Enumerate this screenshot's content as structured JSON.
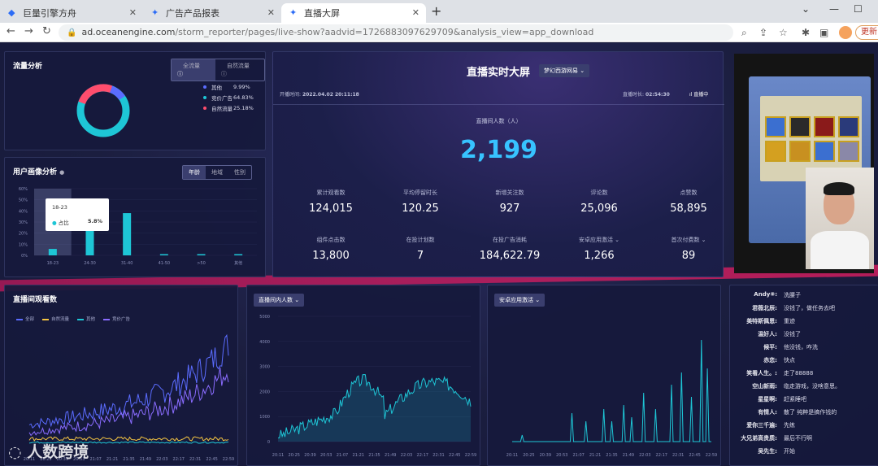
{
  "browser": {
    "tabs": [
      {
        "label": "巨量引擎方舟"
      },
      {
        "label": "广告产品报表"
      },
      {
        "label": "直播大屏"
      }
    ],
    "url_host": "ad.oceanengine.com",
    "url_path": "/storm_reporter/pages/live-show?aadvid=1726883097629709&analysis_view=app_download",
    "update_label": "更新"
  },
  "traffic": {
    "title": "流量分析",
    "tabs": [
      "全流量",
      "自然流量"
    ],
    "legend": [
      {
        "name": "其他",
        "value": "9.99%",
        "color": "#5b6cff"
      },
      {
        "name": "竞价广告",
        "value": "64.83%",
        "color": "#1ec6d6"
      },
      {
        "name": "自然流量",
        "value": "25.18%",
        "color": "#ff4d6d"
      }
    ]
  },
  "profile": {
    "title": "用户画像分析",
    "tabs": [
      "年龄",
      "地域",
      "性别"
    ],
    "yticks": [
      "60%",
      "50%",
      "40%",
      "30%",
      "20%",
      "10%",
      "0%"
    ],
    "categories": [
      "18-23",
      "24-30",
      "31-40",
      "41-50",
      ">50",
      "其他"
    ],
    "values": [
      5.8,
      40,
      38,
      1,
      0.3,
      1
    ],
    "tooltip": {
      "title": "18-23",
      "label": "占比",
      "value": "5.8%"
    }
  },
  "live": {
    "title": "直播实时大屏",
    "game_select": "梦幻西游网易",
    "start_label": "开播时间:",
    "start_time": "2022.04.02 20:11:18",
    "duration_label": "直播时长:",
    "duration": "02:54:30",
    "status": "直播中",
    "viewers_label": "直播间人数（人）",
    "viewers": "2,199",
    "metrics_row1": [
      {
        "label": "累计观看数",
        "value": "124,015"
      },
      {
        "label": "平均停留时长",
        "value": "120.25"
      },
      {
        "label": "新增关注数",
        "value": "927"
      },
      {
        "label": "评论数",
        "value": "25,096"
      },
      {
        "label": "点赞数",
        "value": "58,895"
      }
    ],
    "metrics_row2": [
      {
        "label": "组件点击数",
        "value": "13,800"
      },
      {
        "label": "在投计划数",
        "value": "7"
      },
      {
        "label": "在投广告消耗",
        "value": "184,622.79"
      },
      {
        "label": "安卓应用激活",
        "value": "1,266"
      },
      {
        "label": "首次付费数",
        "value": "89"
      }
    ]
  },
  "charts": {
    "views_title": "直播间观看数",
    "views_legend": [
      "全部",
      "自然流量",
      "其他",
      "竞价广告"
    ],
    "viewers_select": "直播间内人数",
    "viewers_yticks": [
      "5000",
      "4000",
      "3000",
      "2000",
      "1000",
      "0"
    ],
    "activation_select": "安卓应用激活",
    "xticks": [
      "20:11",
      "20:25",
      "20:39",
      "20:53",
      "21:07",
      "21:21",
      "21:35",
      "21:49",
      "22:03",
      "22:17",
      "22:31",
      "22:45",
      "22:59"
    ]
  },
  "chat": [
    {
      "name": "Andy⑧:",
      "msg": "洗腰子"
    },
    {
      "name": "君薇北辰:",
      "msg": "没钱了，做任务去吧"
    },
    {
      "name": "美特斯佩恩:",
      "msg": "重迹"
    },
    {
      "name": "温好人:",
      "msg": "没钱了"
    },
    {
      "name": "候平:",
      "msg": "他没钱，咋洗"
    },
    {
      "name": "赤恋:",
      "msg": "快点"
    },
    {
      "name": "笑看人生。:",
      "msg": "走了88888"
    },
    {
      "name": "空山新雨:",
      "msg": "临走游戏，没啥意思。"
    },
    {
      "name": "星星啊:",
      "msg": "赶紧睡吧"
    },
    {
      "name": "有情人:",
      "msg": "散了 纯粹是搞作钱的"
    },
    {
      "name": "爱你三千遍:",
      "msg": "先练"
    },
    {
      "name": "大兄弟高贵质:",
      "msg": "最后不行啊"
    },
    {
      "name": "吴先生:",
      "msg": "开始"
    }
  ],
  "watermark": "人数跨境"
}
